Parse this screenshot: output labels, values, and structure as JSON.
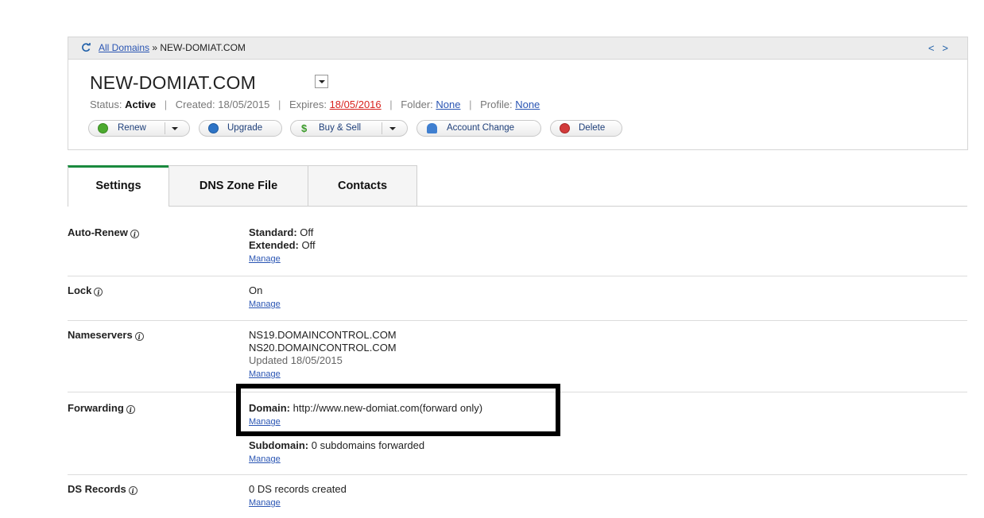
{
  "breadcrumb": {
    "link": "All Domains",
    "separator": " » ",
    "current": "NEW-DOMIAT.COM",
    "prev": "<",
    "next": ">"
  },
  "domain": {
    "title": "NEW-DOMIAT.COM",
    "status_label": "Status:",
    "status_value": "Active",
    "created_label": "Created:",
    "created_value": "18/05/2015",
    "expires_label": "Expires:",
    "expires_value": "18/05/2016",
    "folder_label": "Folder:",
    "folder_value": "None",
    "profile_label": "Profile:",
    "profile_value": "None",
    "sep": "|"
  },
  "actions": {
    "renew": "Renew",
    "upgrade": "Upgrade",
    "buy_sell": "Buy & Sell",
    "account_change": "Account Change",
    "delete": "Delete"
  },
  "tabs": [
    "Settings",
    "DNS Zone File",
    "Contacts"
  ],
  "settings": {
    "auto_renew": {
      "label": "Auto-Renew",
      "standard_label": "Standard:",
      "standard_value": "Off",
      "extended_label": "Extended:",
      "extended_value": "Off",
      "manage": "Manage"
    },
    "lock": {
      "label": "Lock",
      "value": "On",
      "manage": "Manage"
    },
    "nameservers": {
      "label": "Nameservers",
      "ns1": "NS19.DOMAINCONTROL.COM",
      "ns2": "NS20.DOMAINCONTROL.COM",
      "updated": "Updated 18/05/2015",
      "manage": "Manage"
    },
    "forwarding": {
      "label": "Forwarding",
      "domain_label": "Domain:",
      "domain_value": "http://www.new-domiat.com(forward only)",
      "domain_manage": "Manage",
      "subdomain_label": "Subdomain:",
      "subdomain_value": "0 subdomains forwarded",
      "subdomain_manage": "Manage"
    },
    "ds_records": {
      "label": "DS Records",
      "value": "0 DS records created",
      "manage": "Manage"
    }
  },
  "info_glyph": "i",
  "colors": {
    "active_tab": "#1a8a3e",
    "expires": "#d8231f",
    "link": "#2a55b3"
  }
}
